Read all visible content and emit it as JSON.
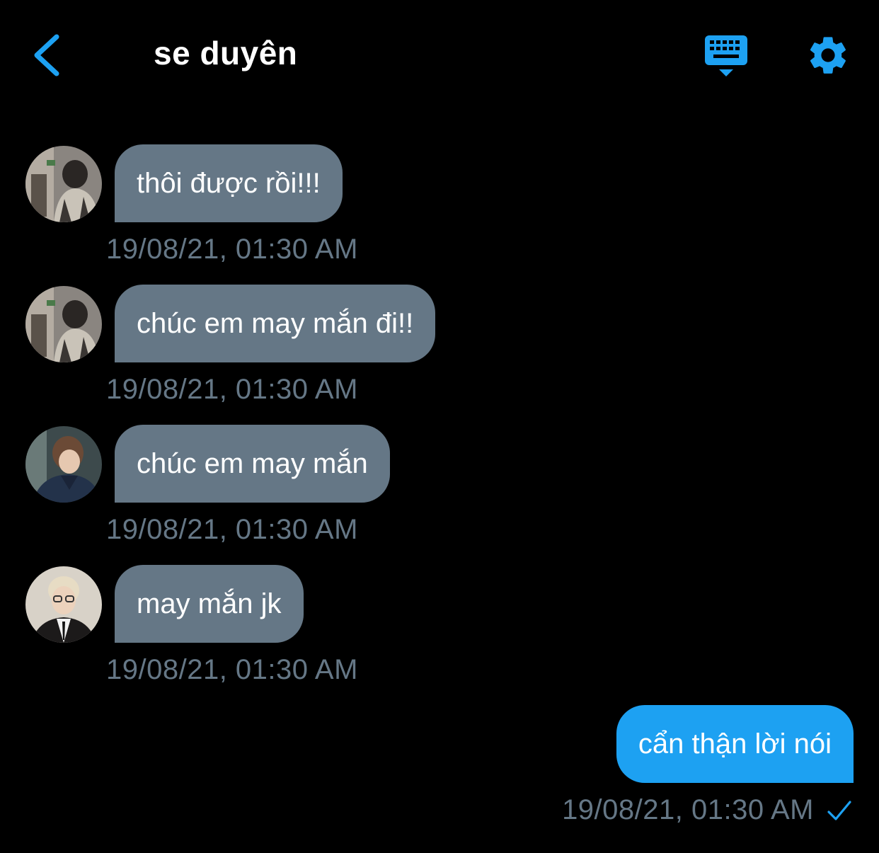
{
  "header": {
    "title": "se duyên",
    "back_icon": "chevron-left-icon",
    "keyboard_icon": "keyboard-icon",
    "settings_icon": "gear-icon",
    "accent_color": "#1da1f2"
  },
  "messages": [
    {
      "direction": "received",
      "text": "thôi được rồi!!!",
      "time": "19/08/21, 01:30 AM"
    },
    {
      "direction": "received",
      "text": "chúc em may mắn đi!!",
      "time": "19/08/21, 01:30 AM"
    },
    {
      "direction": "received",
      "text": "chúc em may mắn",
      "time": "19/08/21, 01:30 AM"
    },
    {
      "direction": "received",
      "text": "may mắn jk",
      "time": "19/08/21, 01:30 AM"
    },
    {
      "direction": "sent",
      "text": "cẩn thận lời nói",
      "time": "19/08/21, 01:30 AM",
      "status_icon": "checkmark-icon"
    }
  ],
  "colors": {
    "background": "#000000",
    "received_bubble": "#657786",
    "sent_bubble": "#1da1f2",
    "timestamp": "#657786"
  }
}
